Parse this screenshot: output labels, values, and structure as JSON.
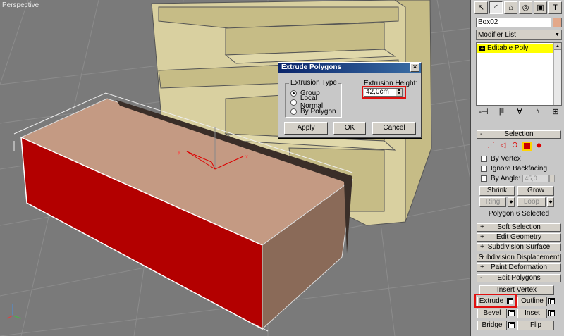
{
  "viewport": {
    "label": "Perspective"
  },
  "dialog": {
    "title": "Extrude Polygons",
    "close": "×",
    "type_group_label": "Extrusion Type",
    "types": [
      {
        "label": "Group",
        "selected": true
      },
      {
        "label": "Local Normal",
        "selected": false
      },
      {
        "label": "By Polygon",
        "selected": false
      }
    ],
    "height_label": "Extrusion Height:",
    "height_value": "42,0cm",
    "buttons": {
      "apply": "Apply",
      "ok": "OK",
      "cancel": "Cancel"
    }
  },
  "panel": {
    "tabs": [
      {
        "icon": "create-icon",
        "glyph": "↖"
      },
      {
        "icon": "modify-icon",
        "glyph": "◜"
      },
      {
        "icon": "hierarchy-icon",
        "glyph": "⌂"
      },
      {
        "icon": "motion-icon",
        "glyph": "◎"
      },
      {
        "icon": "display-icon",
        "glyph": "▣"
      },
      {
        "icon": "utilities-icon",
        "glyph": "T"
      }
    ],
    "object_name": "Box02",
    "object_color": "#e3a88a",
    "modifier_list": "Modifier List",
    "stack_item": "Editable Poly",
    "stack_highlight": "#ffff00",
    "stack_tools": [
      "-⊣",
      "|‖",
      "∀",
      "♁",
      "⊞"
    ],
    "selection": {
      "title": "Selection",
      "by_vertex": "By Vertex",
      "ignore_backfacing": "Ignore Backfacing",
      "by_angle": "By Angle:",
      "angle_value": "45,0",
      "shrink": "Shrink",
      "grow": "Grow",
      "ring": "Ring",
      "loop": "Loop",
      "status": "Polygon 6 Selected"
    },
    "rollouts": {
      "soft": "Soft Selection",
      "geometry": "Edit Geometry",
      "subdiv": "Subdivision Surface",
      "subdiv_disp": "Subdivision Displacement",
      "paint": "Paint Deformation",
      "edit_polygons": "Edit Polygons"
    },
    "edit_polygons": {
      "insert_vertex": "Insert Vertex",
      "extrude": "Extrude",
      "outline": "Outline",
      "bevel": "Bevel",
      "inset": "Inset",
      "bridge": "Bridge",
      "flip": "Flip"
    },
    "signs": {
      "open": "-",
      "closed": "+"
    }
  },
  "colors": {
    "accent_red": "#e01010",
    "selected_face": "#b30000",
    "box_face": "#c49a83",
    "shelf": "#d9d0a0"
  }
}
